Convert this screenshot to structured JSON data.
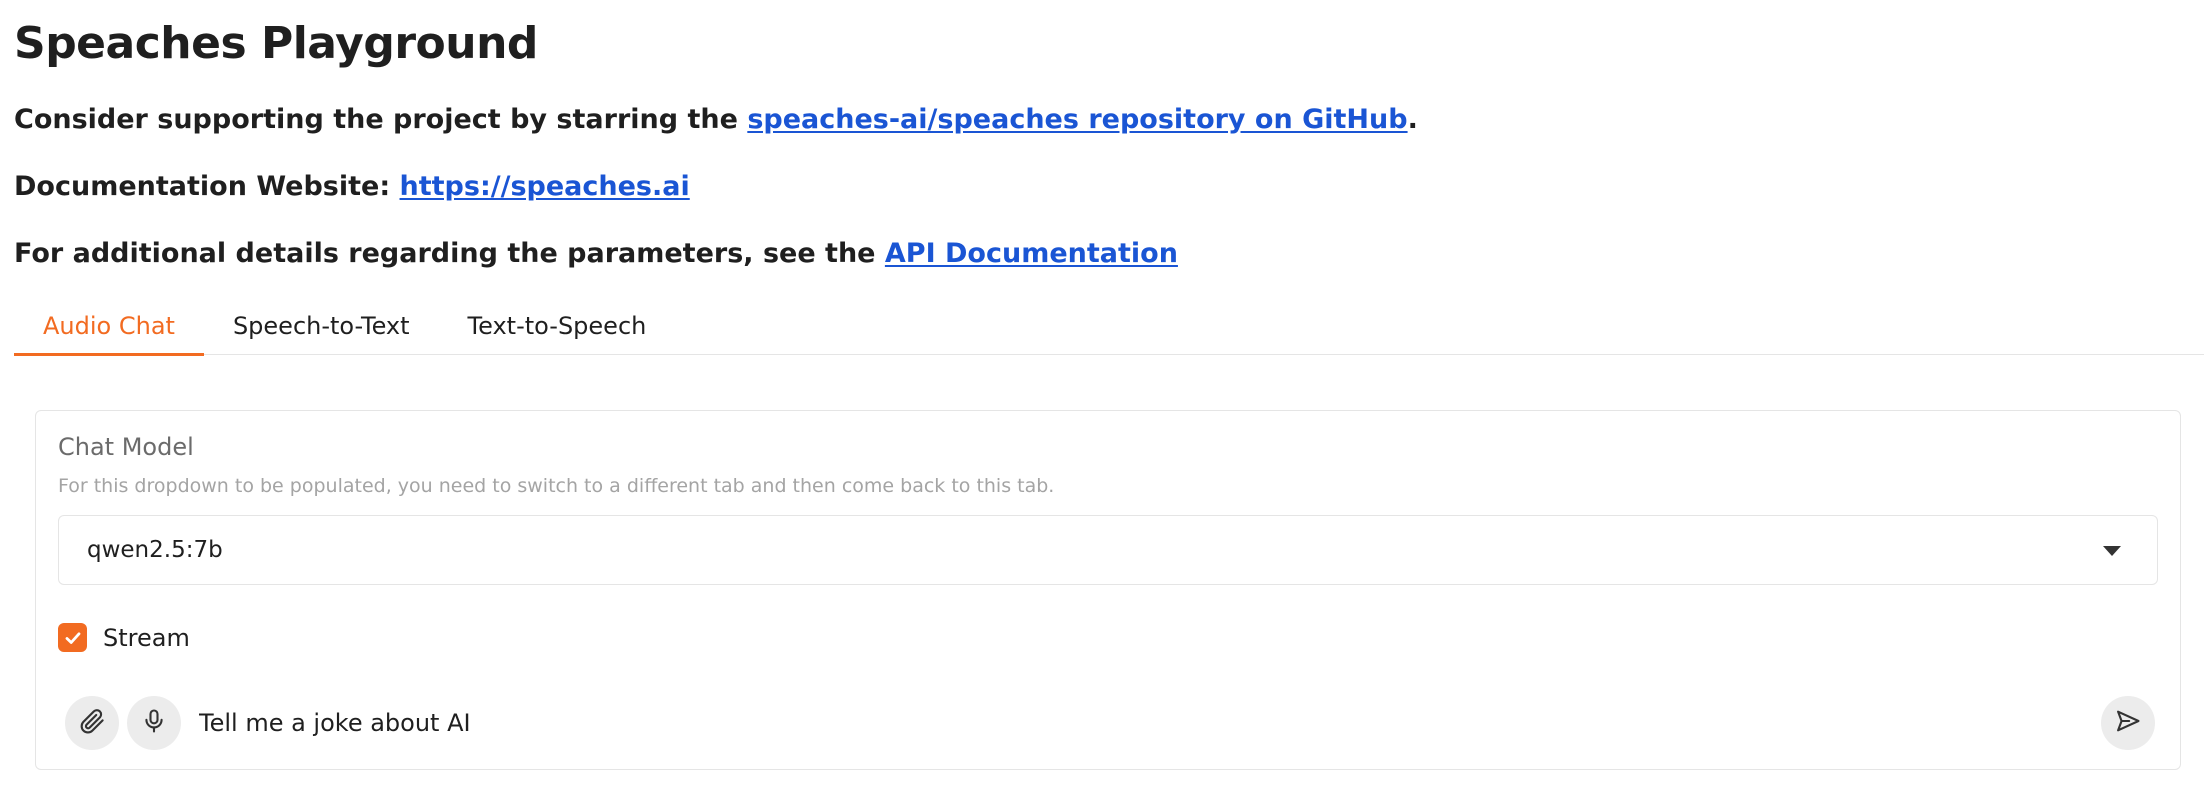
{
  "page": {
    "title": "Speaches Playground",
    "support": {
      "prefix": "Consider supporting the project by starring the ",
      "link": "speaches-ai/speaches repository on GitHub",
      "suffix": "."
    },
    "docs": {
      "prefix": "Documentation Website: ",
      "link": "https://speaches.ai"
    },
    "api": {
      "prefix": "For additional details regarding the parameters, see the ",
      "link": "API Documentation"
    }
  },
  "tabs": [
    {
      "label": "Audio Chat",
      "active": true
    },
    {
      "label": "Speech-to-Text",
      "active": false
    },
    {
      "label": "Text-to-Speech",
      "active": false
    }
  ],
  "chat": {
    "model_label": "Chat Model",
    "model_info": "For this dropdown to be populated, you need to switch to a different tab and then come back to this tab.",
    "model_value": "qwen2.5:7b",
    "stream_label": "Stream",
    "stream_checked": true,
    "message_value": "Tell me a joke about AI"
  },
  "colors": {
    "accent": "#f26b21",
    "link": "#1a55d4"
  },
  "icons": {
    "attach": "paperclip-icon",
    "mic": "microphone-icon",
    "send": "send-icon",
    "dropdown": "chevron-down-icon",
    "check": "check-icon"
  }
}
